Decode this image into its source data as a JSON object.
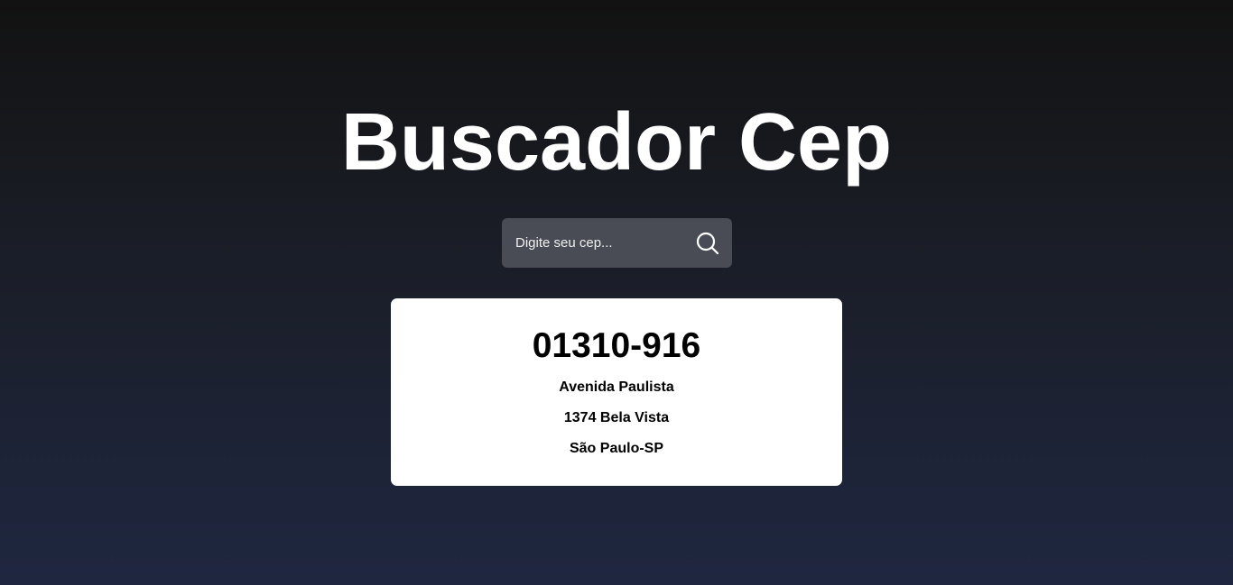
{
  "header": {
    "title": "Buscador Cep"
  },
  "search": {
    "placeholder": "Digite seu cep...",
    "value": "",
    "button_icon": "search-icon"
  },
  "result": {
    "cep": "01310-916",
    "street": "Avenida Paulista",
    "complement_neighborhood": "1374 Bela Vista",
    "city_state": "São Paulo-SP"
  },
  "colors": {
    "background_top": "#121212",
    "background_bottom": "#1f2740",
    "search_box": "#4a4c55",
    "card": "#ffffff",
    "title_text": "#ffffff",
    "card_text": "#000000"
  }
}
